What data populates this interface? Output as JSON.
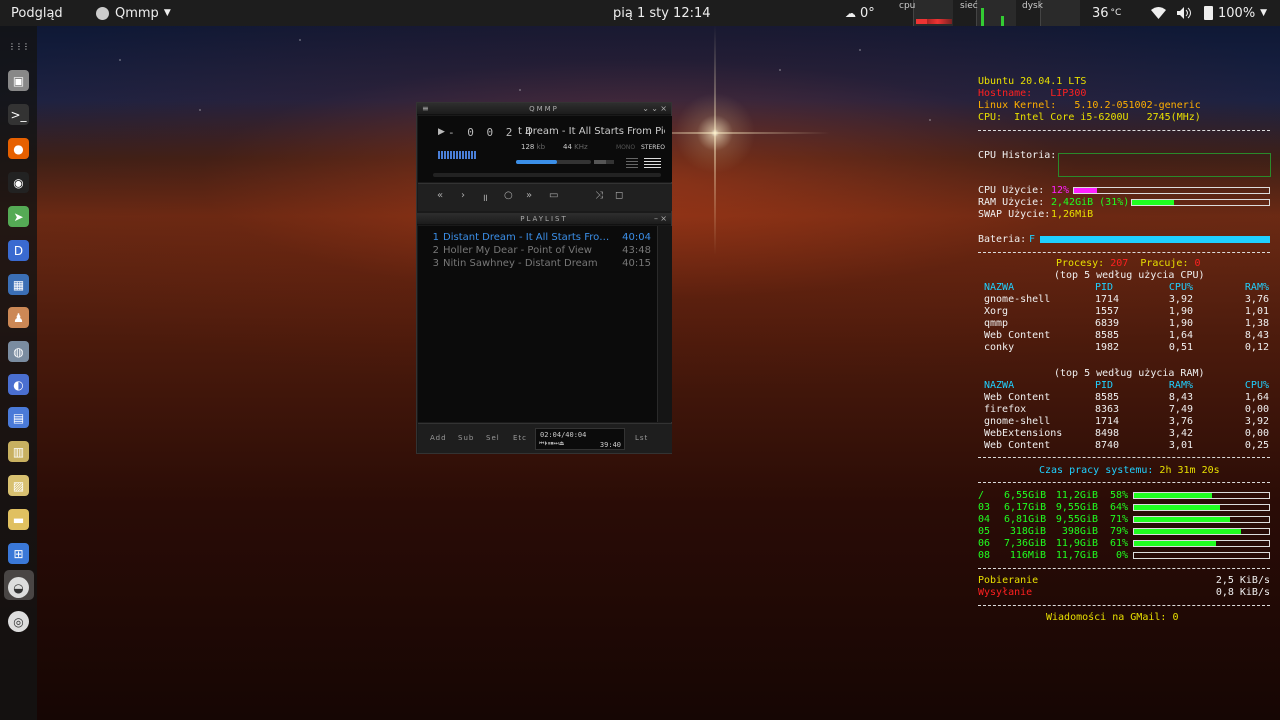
{
  "topbar": {
    "activities": "Podgląd",
    "app_menu": "Qmmp",
    "clock": "pią 1 sty  12:14",
    "weather": "0°",
    "cpu_label": "cpu",
    "net_label": "sieć",
    "disk_label": "dysk",
    "temp": "36",
    "temp_unit": "°C",
    "battery": "100%"
  },
  "dock": {
    "icons": [
      "apps-grid-icon",
      "files-icon",
      "terminal-icon",
      "firefox-icon",
      "music-icon",
      "arrow-app-icon",
      "dict-icon",
      "calendar-icon",
      "user-icon",
      "globe-icon",
      "tool-icon",
      "doc-icon",
      "archive-icon",
      "image-icon",
      "folder-icon",
      "calc-icon",
      "qmmp-icon",
      "disc-icon"
    ]
  },
  "qmmp": {
    "title": "QMMP",
    "time_display": "- 0 0 2 4",
    "scroll_title": "t Dream - It All Starts From Pie",
    "bitrate": "128",
    "bitrate_unit": "kb",
    "samplerate": "44",
    "samplerate_unit": "KHz",
    "mono": "MONO",
    "stereo": "STEREO",
    "seek_fraction": 0.55,
    "volume_fraction": 0.6,
    "playlist_title": "PLAYLIST",
    "playlist": [
      {
        "num": "1",
        "name": "Distant Dream - It All Starts From Pie",
        "time": "40:04",
        "active": true
      },
      {
        "num": "2",
        "name": "Holler My Dear - Point of View",
        "time": "43:48",
        "active": false
      },
      {
        "num": "3",
        "name": "Nitin Sawhney - Distant Dream",
        "time": "40:15",
        "active": false
      }
    ],
    "buttons": {
      "add": "Add",
      "sub": "Sub",
      "sel": "Sel",
      "etc": "Etc",
      "lst": "Lst"
    },
    "mini_time": "02:04/40:04",
    "mini_remaining": "39:40"
  },
  "conky": {
    "os": "Ubuntu 20.04.1 LTS",
    "hostname_label": "Hostname:",
    "hostname": "LIP300",
    "kernel_label": "Linux Kernel:",
    "kernel": "5.10.2-051002-generic",
    "cpu_label": "CPU:",
    "cpu_model": "Intel Core i5-6200U",
    "cpu_freq": "2745(MHz)",
    "history_label": "CPU Historia:",
    "cpu_use_label": "CPU  Użycie:",
    "cpu_use": "12%",
    "cpu_use_fraction": 0.12,
    "ram_use_label": "RAM  Użycie:",
    "ram_use": "2,42GiB (31%)",
    "ram_use_fraction": 0.31,
    "swap_use_label": "SWAP Użycie:",
    "swap_use": "1,26MiB",
    "battery_label": "Bateria:",
    "battery_state": "F",
    "battery_fraction": 1.0,
    "processes_label": "Procesy:",
    "processes": "207",
    "running_label": "Pracuje:",
    "running": "0",
    "top_cpu_title": "(top 5 według użycia CPU)",
    "top_cpu_headers": [
      "NAZWA",
      "PID",
      "CPU%",
      "RAM%"
    ],
    "top_cpu": [
      [
        "gnome-shell",
        "1714",
        "3,92",
        "3,76"
      ],
      [
        "Xorg",
        "1557",
        "1,90",
        "1,01"
      ],
      [
        "qmmp",
        "6839",
        "1,90",
        "1,38"
      ],
      [
        "Web Content",
        "8585",
        "1,64",
        "8,43"
      ],
      [
        "conky",
        "1982",
        "0,51",
        "0,12"
      ]
    ],
    "top_ram_title": "(top 5 według użycia RAM)",
    "top_ram_headers": [
      "NAZWA",
      "PID",
      "RAM%",
      "CPU%"
    ],
    "top_ram": [
      [
        "Web Content",
        "8585",
        "8,43",
        "1,64"
      ],
      [
        "firefox",
        "8363",
        "7,49",
        "0,00"
      ],
      [
        "gnome-shell",
        "1714",
        "3,76",
        "3,92"
      ],
      [
        "WebExtensions",
        "8498",
        "3,42",
        "0,00"
      ],
      [
        "Web Content",
        "8740",
        "3,01",
        "0,25"
      ]
    ],
    "uptime_label": "Czas pracy systemu:",
    "uptime": "2h 31m 20s",
    "disks": [
      {
        "mount": "/",
        "used": "6,55GiB",
        "size": "11,2GiB",
        "pct": "58%",
        "fraction": 0.58
      },
      {
        "mount": "03",
        "used": "6,17GiB",
        "size": "9,55GiB",
        "pct": "64%",
        "fraction": 0.64
      },
      {
        "mount": "04",
        "used": "6,81GiB",
        "size": "9,55GiB",
        "pct": "71%",
        "fraction": 0.71
      },
      {
        "mount": "05",
        "used": "318GiB",
        "size": "398GiB",
        "pct": "79%",
        "fraction": 0.79
      },
      {
        "mount": "06",
        "used": "7,36GiB",
        "size": "11,9GiB",
        "pct": "61%",
        "fraction": 0.61
      },
      {
        "mount": "08",
        "used": "116MiB",
        "size": "11,7GiB",
        "pct": "0%",
        "fraction": 0.0
      }
    ],
    "download_label": "Pobieranie",
    "download": "2,5 KiB/s",
    "upload_label": "Wysyłanie",
    "upload": "0,8 KiB/s",
    "gmail_label": "Wiadomości na GMail:",
    "gmail": "0"
  },
  "colors": {
    "accent_blue": "#3b8fe8",
    "conky_green": "#20ff20",
    "conky_yellow": "#e8e000",
    "conky_red": "#ff2020",
    "conky_cyan": "#20d0ff",
    "conky_magenta": "#ff20ff"
  }
}
